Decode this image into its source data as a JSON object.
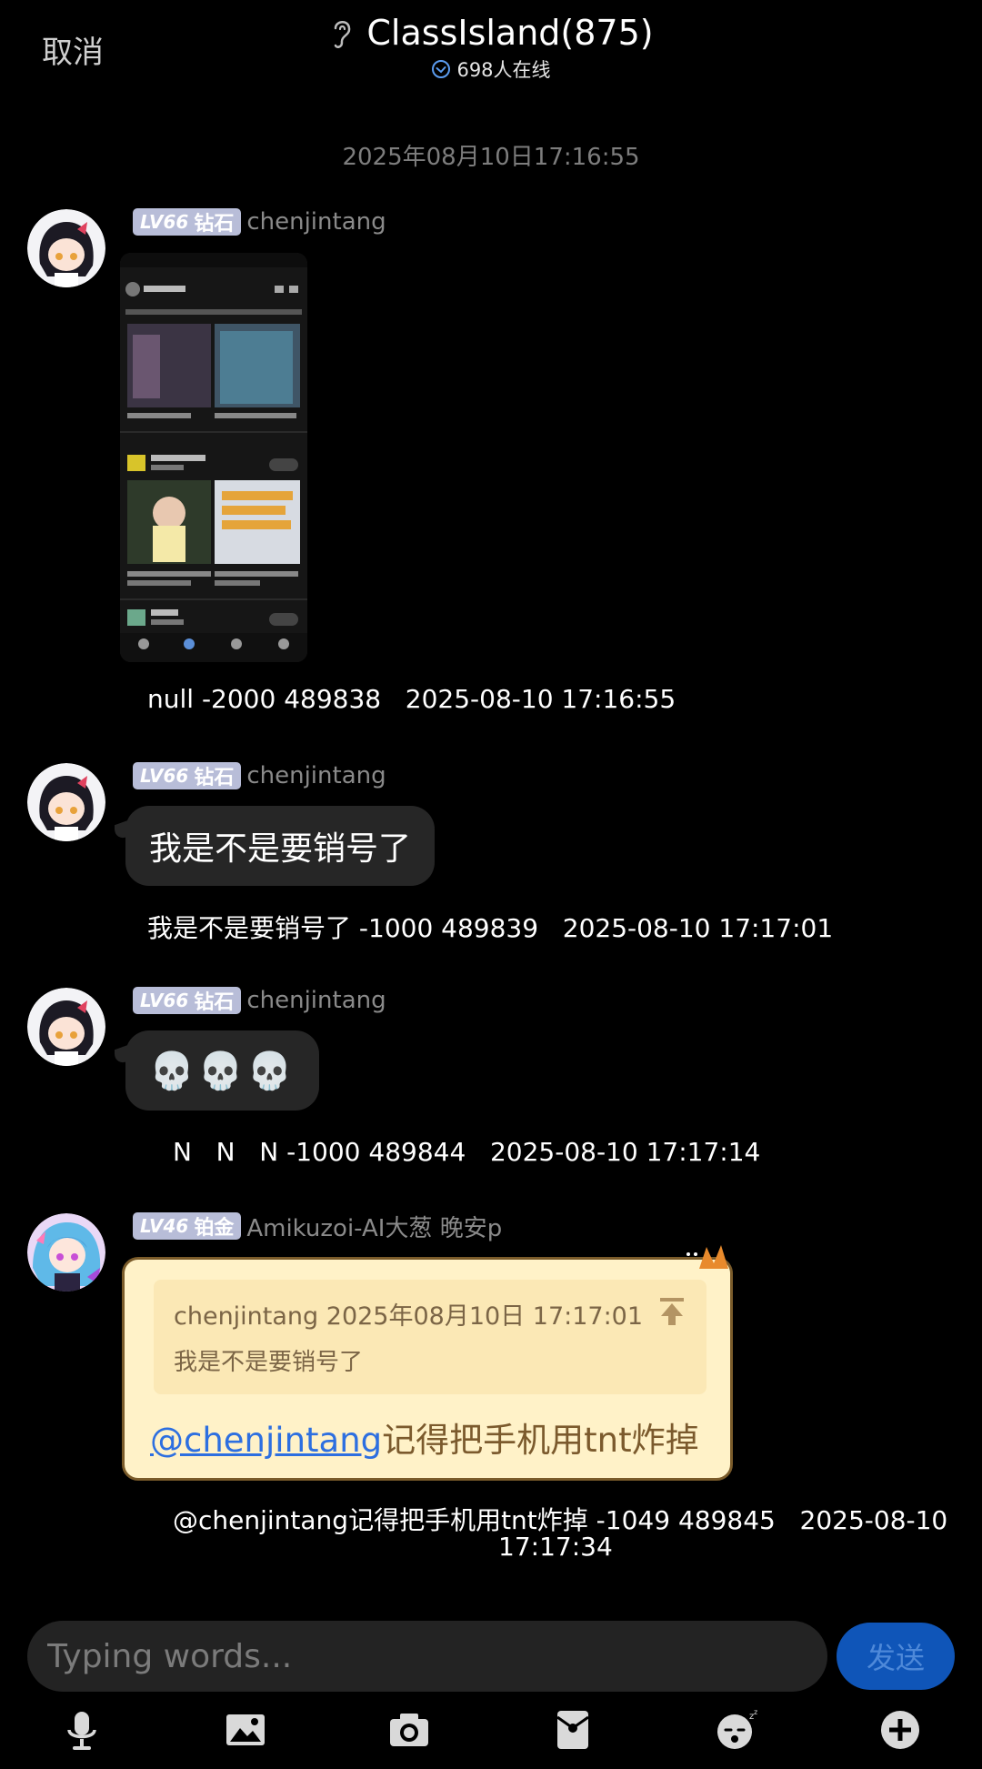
{
  "header": {
    "cancel_label": "取消",
    "title": "ClassIsland(875)",
    "online": "698人在线"
  },
  "date_separator": "2025年08月10日17:16:55",
  "messages": [
    {
      "level": "LV66",
      "rank": "钻石",
      "sender": "chenjintang",
      "type": "image",
      "debug": "null -2000 489838   2025-08-10 17:16:55"
    },
    {
      "level": "LV66",
      "rank": "钻石",
      "sender": "chenjintang",
      "type": "text",
      "text": "我是不是要销号了",
      "debug": "我是不是要销号了 -1000 489839   2025-08-10 17:17:01"
    },
    {
      "level": "LV66",
      "rank": "钻石",
      "sender": "chenjintang",
      "type": "text",
      "text": "💀💀💀",
      "debug": "N   N   N -1000 489844   2025-08-10 17:17:14"
    },
    {
      "level": "LV46",
      "rank": "铂金",
      "sender": "Amikuzoi-AI大葱 晚安p",
      "type": "reply",
      "quote_header": "chenjintang 2025年08月10日 17:17:01",
      "quote_text": "我是不是要销号了",
      "mention": "@chenjintang",
      "text": "记得把手机用tnt炸掉",
      "debug_line1": "@chenjintang记得把手机用tnt炸掉 -1049 489845   2025-08-10",
      "debug_line2": "17:17:34"
    }
  ],
  "input": {
    "placeholder": "Typing words...",
    "send_label": "发送"
  },
  "toolbar_icons": [
    "microphone-icon",
    "image-icon",
    "camera-icon",
    "red-packet-icon",
    "sticker-icon",
    "plus-icon"
  ],
  "colors": {
    "background": "#000000",
    "bubble": "#262626",
    "badge": "#b8bdd8",
    "send_button": "#0f55b8",
    "gold_bubble": "#fff2c8",
    "mention": "#2d6fe0"
  }
}
